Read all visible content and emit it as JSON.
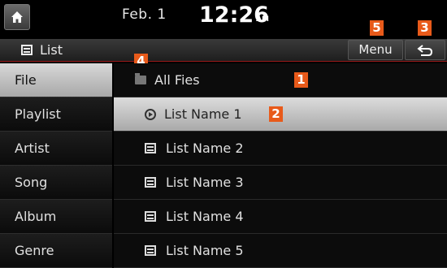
{
  "status": {
    "date": "Feb.  1",
    "time": "12:26",
    "ampm": "AM"
  },
  "header": {
    "title": "List",
    "menu_label": "Menu"
  },
  "callouts": [
    "1",
    "2",
    "3",
    "4",
    "5"
  ],
  "sidebar": {
    "items": [
      {
        "label": "File"
      },
      {
        "label": "Playlist"
      },
      {
        "label": "Artist"
      },
      {
        "label": "Song"
      },
      {
        "label": "Album"
      },
      {
        "label": "Genre"
      }
    ]
  },
  "content": {
    "folder_label": "All Fies",
    "items": [
      {
        "label": "List Name 1"
      },
      {
        "label": "List Name 2"
      },
      {
        "label": "List Name 3"
      },
      {
        "label": "List Name 4"
      },
      {
        "label": "List Name 5"
      }
    ]
  },
  "colors": {
    "callout": "#e85a1a",
    "header_underline": "#9a1a1a",
    "selected_bg": "#c8c8c8"
  }
}
